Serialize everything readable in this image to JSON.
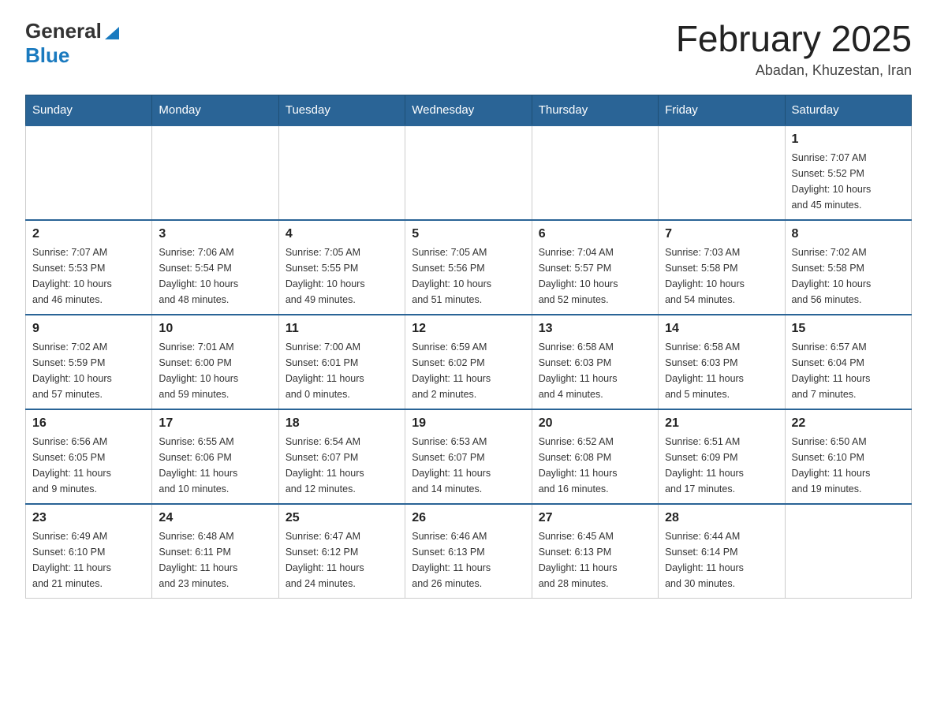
{
  "header": {
    "logo_general": "General",
    "logo_blue": "Blue",
    "title": "February 2025",
    "subtitle": "Abadan, Khuzestan, Iran"
  },
  "days_of_week": [
    "Sunday",
    "Monday",
    "Tuesday",
    "Wednesday",
    "Thursday",
    "Friday",
    "Saturday"
  ],
  "weeks": [
    {
      "days": [
        {
          "number": "",
          "info": ""
        },
        {
          "number": "",
          "info": ""
        },
        {
          "number": "",
          "info": ""
        },
        {
          "number": "",
          "info": ""
        },
        {
          "number": "",
          "info": ""
        },
        {
          "number": "",
          "info": ""
        },
        {
          "number": "1",
          "info": "Sunrise: 7:07 AM\nSunset: 5:52 PM\nDaylight: 10 hours\nand 45 minutes."
        }
      ]
    },
    {
      "days": [
        {
          "number": "2",
          "info": "Sunrise: 7:07 AM\nSunset: 5:53 PM\nDaylight: 10 hours\nand 46 minutes."
        },
        {
          "number": "3",
          "info": "Sunrise: 7:06 AM\nSunset: 5:54 PM\nDaylight: 10 hours\nand 48 minutes."
        },
        {
          "number": "4",
          "info": "Sunrise: 7:05 AM\nSunset: 5:55 PM\nDaylight: 10 hours\nand 49 minutes."
        },
        {
          "number": "5",
          "info": "Sunrise: 7:05 AM\nSunset: 5:56 PM\nDaylight: 10 hours\nand 51 minutes."
        },
        {
          "number": "6",
          "info": "Sunrise: 7:04 AM\nSunset: 5:57 PM\nDaylight: 10 hours\nand 52 minutes."
        },
        {
          "number": "7",
          "info": "Sunrise: 7:03 AM\nSunset: 5:58 PM\nDaylight: 10 hours\nand 54 minutes."
        },
        {
          "number": "8",
          "info": "Sunrise: 7:02 AM\nSunset: 5:58 PM\nDaylight: 10 hours\nand 56 minutes."
        }
      ]
    },
    {
      "days": [
        {
          "number": "9",
          "info": "Sunrise: 7:02 AM\nSunset: 5:59 PM\nDaylight: 10 hours\nand 57 minutes."
        },
        {
          "number": "10",
          "info": "Sunrise: 7:01 AM\nSunset: 6:00 PM\nDaylight: 10 hours\nand 59 minutes."
        },
        {
          "number": "11",
          "info": "Sunrise: 7:00 AM\nSunset: 6:01 PM\nDaylight: 11 hours\nand 0 minutes."
        },
        {
          "number": "12",
          "info": "Sunrise: 6:59 AM\nSunset: 6:02 PM\nDaylight: 11 hours\nand 2 minutes."
        },
        {
          "number": "13",
          "info": "Sunrise: 6:58 AM\nSunset: 6:03 PM\nDaylight: 11 hours\nand 4 minutes."
        },
        {
          "number": "14",
          "info": "Sunrise: 6:58 AM\nSunset: 6:03 PM\nDaylight: 11 hours\nand 5 minutes."
        },
        {
          "number": "15",
          "info": "Sunrise: 6:57 AM\nSunset: 6:04 PM\nDaylight: 11 hours\nand 7 minutes."
        }
      ]
    },
    {
      "days": [
        {
          "number": "16",
          "info": "Sunrise: 6:56 AM\nSunset: 6:05 PM\nDaylight: 11 hours\nand 9 minutes."
        },
        {
          "number": "17",
          "info": "Sunrise: 6:55 AM\nSunset: 6:06 PM\nDaylight: 11 hours\nand 10 minutes."
        },
        {
          "number": "18",
          "info": "Sunrise: 6:54 AM\nSunset: 6:07 PM\nDaylight: 11 hours\nand 12 minutes."
        },
        {
          "number": "19",
          "info": "Sunrise: 6:53 AM\nSunset: 6:07 PM\nDaylight: 11 hours\nand 14 minutes."
        },
        {
          "number": "20",
          "info": "Sunrise: 6:52 AM\nSunset: 6:08 PM\nDaylight: 11 hours\nand 16 minutes."
        },
        {
          "number": "21",
          "info": "Sunrise: 6:51 AM\nSunset: 6:09 PM\nDaylight: 11 hours\nand 17 minutes."
        },
        {
          "number": "22",
          "info": "Sunrise: 6:50 AM\nSunset: 6:10 PM\nDaylight: 11 hours\nand 19 minutes."
        }
      ]
    },
    {
      "days": [
        {
          "number": "23",
          "info": "Sunrise: 6:49 AM\nSunset: 6:10 PM\nDaylight: 11 hours\nand 21 minutes."
        },
        {
          "number": "24",
          "info": "Sunrise: 6:48 AM\nSunset: 6:11 PM\nDaylight: 11 hours\nand 23 minutes."
        },
        {
          "number": "25",
          "info": "Sunrise: 6:47 AM\nSunset: 6:12 PM\nDaylight: 11 hours\nand 24 minutes."
        },
        {
          "number": "26",
          "info": "Sunrise: 6:46 AM\nSunset: 6:13 PM\nDaylight: 11 hours\nand 26 minutes."
        },
        {
          "number": "27",
          "info": "Sunrise: 6:45 AM\nSunset: 6:13 PM\nDaylight: 11 hours\nand 28 minutes."
        },
        {
          "number": "28",
          "info": "Sunrise: 6:44 AM\nSunset: 6:14 PM\nDaylight: 11 hours\nand 30 minutes."
        },
        {
          "number": "",
          "info": ""
        }
      ]
    }
  ]
}
